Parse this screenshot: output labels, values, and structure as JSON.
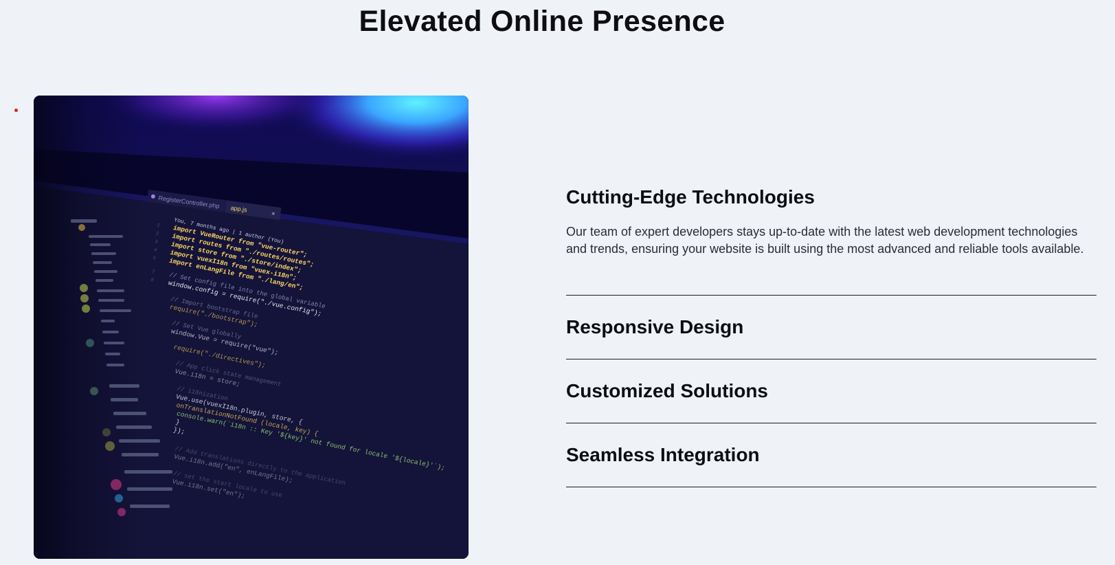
{
  "page": {
    "title": "Elevated Online Presence"
  },
  "features": [
    {
      "title": "Cutting-Edge Technologies",
      "description": "Our team of expert developers stays up-to-date with the latest web development technologies and trends, ensuring your website is built using the most advanced and reliable tools available.",
      "expanded": true
    },
    {
      "title": "Responsive Design",
      "expanded": false
    },
    {
      "title": "Customized Solutions",
      "expanded": false
    },
    {
      "title": "Seamless Integration",
      "expanded": false
    }
  ],
  "image": {
    "subject": "code editor screenshot",
    "tab_file": "RegisterController.php",
    "tab_active": "app.js",
    "git_blame": "You, 7 months ago | 1 author (You)",
    "code_lines": [
      "import VueRouter from \"vue-router\";",
      "import routes from \"./routes/routes\";",
      "import store from \"./store/index\";",
      "import vuexI18n from \"vuex-i18n\";",
      "import enLangFile from \"./lang/en\";",
      "// Set config file into the global variable",
      "window.config = require(\"./vue.config\");",
      "// Import bootstrap file",
      "require(\"./bootstrap\");",
      "// Set Vue globally",
      "window.Vue = require(\"vue\");",
      "require(\"./directives\");",
      "// App click state management",
      "Vue.i18n = store;",
      "// i18nization",
      "Vue.use(vuexI18n.plugin, store, {",
      "onTranslationNotFound (locale, key) {",
      "console.warn(`i18n :: Key '${key}' not found for locale '${locale}'`);",
      "}",
      "});",
      "// Add translations directly to the application",
      "Vue.i18n.add(\"en\", enLangFile);",
      "// set the start locale to use",
      "Vue.i18n.set(\"en\");"
    ]
  },
  "colors": {
    "background": "#eff3f8",
    "text": "#0d0d12",
    "accent_dot": "#e02020",
    "image_base": "#0b0a35"
  }
}
